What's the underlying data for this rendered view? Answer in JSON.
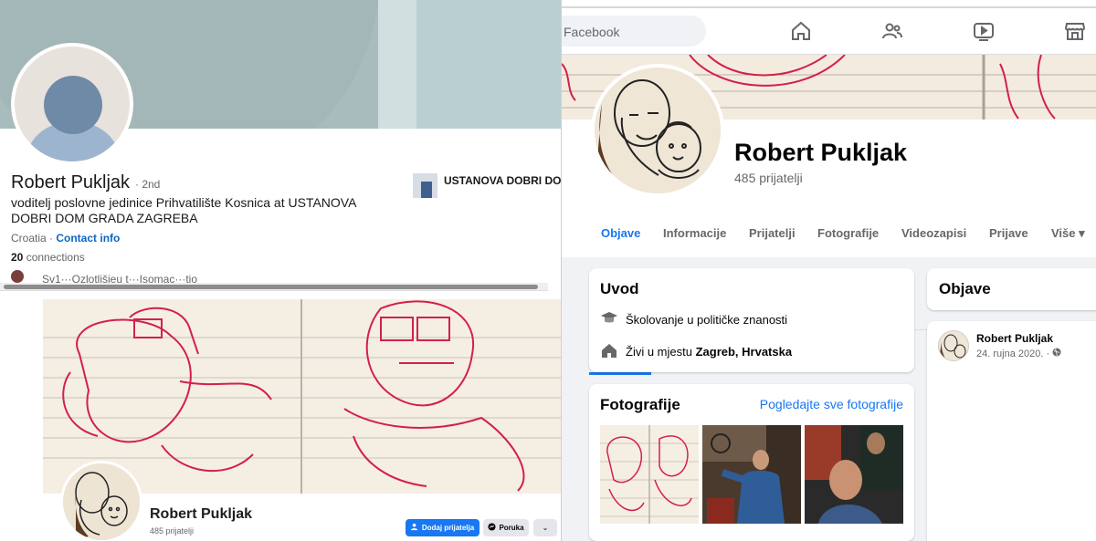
{
  "linkedin": {
    "name": "Robert Pukljak",
    "degree": "· 2nd",
    "headline": "voditelj poslovne jedinice Prihvatilište Kosnica at USTANOVA DOBRI DOM GRADA ZAGREBA",
    "location": "Croatia",
    "location_sep": " · ",
    "contact_info": "Contact info",
    "connections_count": "20",
    "connections_label": "connections",
    "mutual_text": "Sv1···Ozlotlišjeu t···Isomac···tio",
    "org_name": "USTANOVA DOBRI DOM GRADA ZAGREBA",
    "colors": {
      "link": "#0a66c2",
      "cover": "#a9bcbd"
    }
  },
  "fb_small": {
    "name": "Robert Pukljak",
    "friends": "485 prijatelji",
    "add_friend": "Dodaj prijatelja",
    "message": "Poruka",
    "more": "⌄"
  },
  "facebook": {
    "search_placeholder": "Facebook",
    "nav_icons": [
      "home-icon",
      "friends-icon",
      "watch-icon",
      "marketplace-icon"
    ],
    "name": "Robert Pukljak",
    "friends": "485 prijatelji",
    "tabs": [
      {
        "label": "Objave",
        "active": true
      },
      {
        "label": "Informacije",
        "active": false
      },
      {
        "label": "Prijatelji",
        "active": false
      },
      {
        "label": "Fotografije",
        "active": false
      },
      {
        "label": "Videozapisi",
        "active": false
      },
      {
        "label": "Prijave",
        "active": false
      },
      {
        "label": "Više ▾",
        "active": false
      }
    ],
    "intro": {
      "title": "Uvod",
      "education": "Školovanje u političke znanosti",
      "lives_prefix": "Živi u mjestu ",
      "lives_place": "Zagreb, Hrvatska"
    },
    "photos": {
      "title": "Fotografije",
      "see_all": "Pogledajte sve fotografije"
    },
    "posts": {
      "title": "Objave",
      "author": "Robert Pukljak",
      "date": "24. rujna 2020. ·"
    },
    "colors": {
      "accent": "#1877f2",
      "background": "#f0f2f5"
    }
  }
}
